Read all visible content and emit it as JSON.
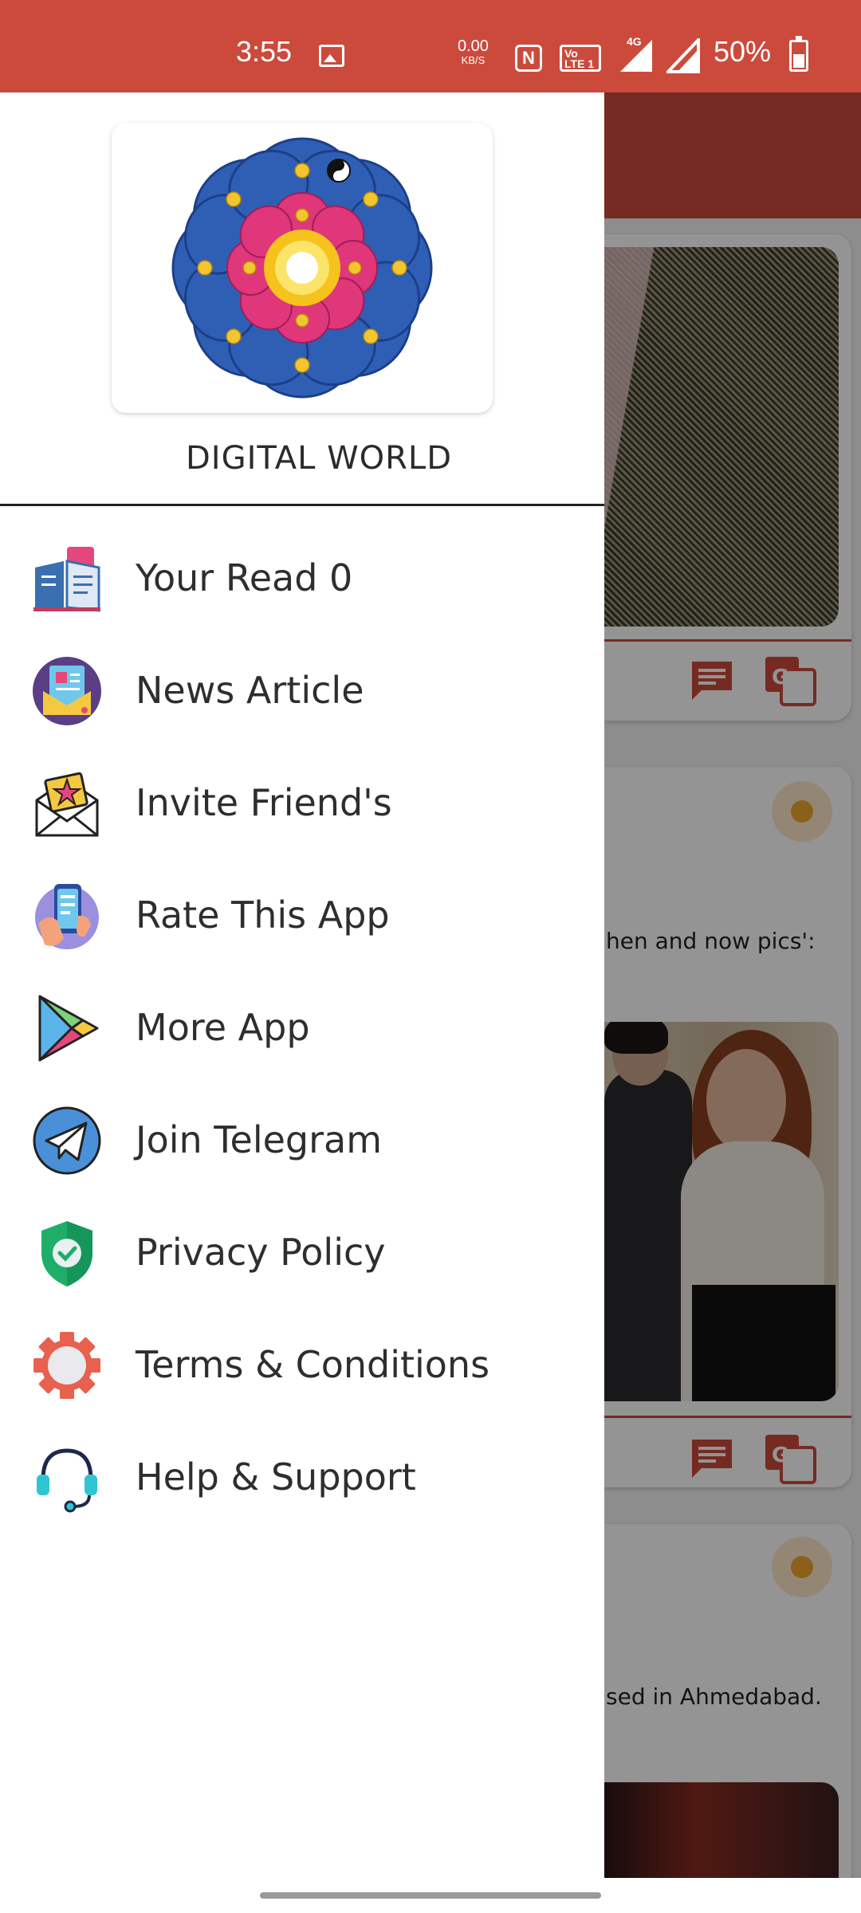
{
  "status_bar": {
    "time": "3:55",
    "net_speed_value": "0.00",
    "net_speed_unit": "KB/S",
    "nfc": "N",
    "volte": "Vo LTE 1",
    "network": "4G",
    "battery_percent": "50%",
    "battery_level": 0.5
  },
  "drawer": {
    "app_name": "DIGITAL WORLD",
    "logo_icon": "religious-symbols-lotus-icon",
    "menu": [
      {
        "label": "Your Read 0",
        "icon": "book-reading-icon"
      },
      {
        "label": "News Article",
        "icon": "news-article-icon"
      },
      {
        "label": "Invite Friend's",
        "icon": "invite-envelope-icon"
      },
      {
        "label": "Rate This App",
        "icon": "rate-phone-icon"
      },
      {
        "label": "More App",
        "icon": "play-store-icon"
      },
      {
        "label": "Join Telegram",
        "icon": "telegram-icon"
      },
      {
        "label": "Privacy Policy",
        "icon": "shield-check-icon"
      },
      {
        "label": "Terms & Conditions",
        "icon": "gear-icon"
      },
      {
        "label": "Help & Support",
        "icon": "headset-icon"
      }
    ]
  },
  "background_feed": {
    "snippet_1": "hen and now pics':",
    "snippet_2": "sed in Ahmedabad."
  },
  "colors": {
    "accent": "#cc4a3c",
    "status_bar": "#cc4a3c",
    "menu_text": "#2e2e2e"
  }
}
